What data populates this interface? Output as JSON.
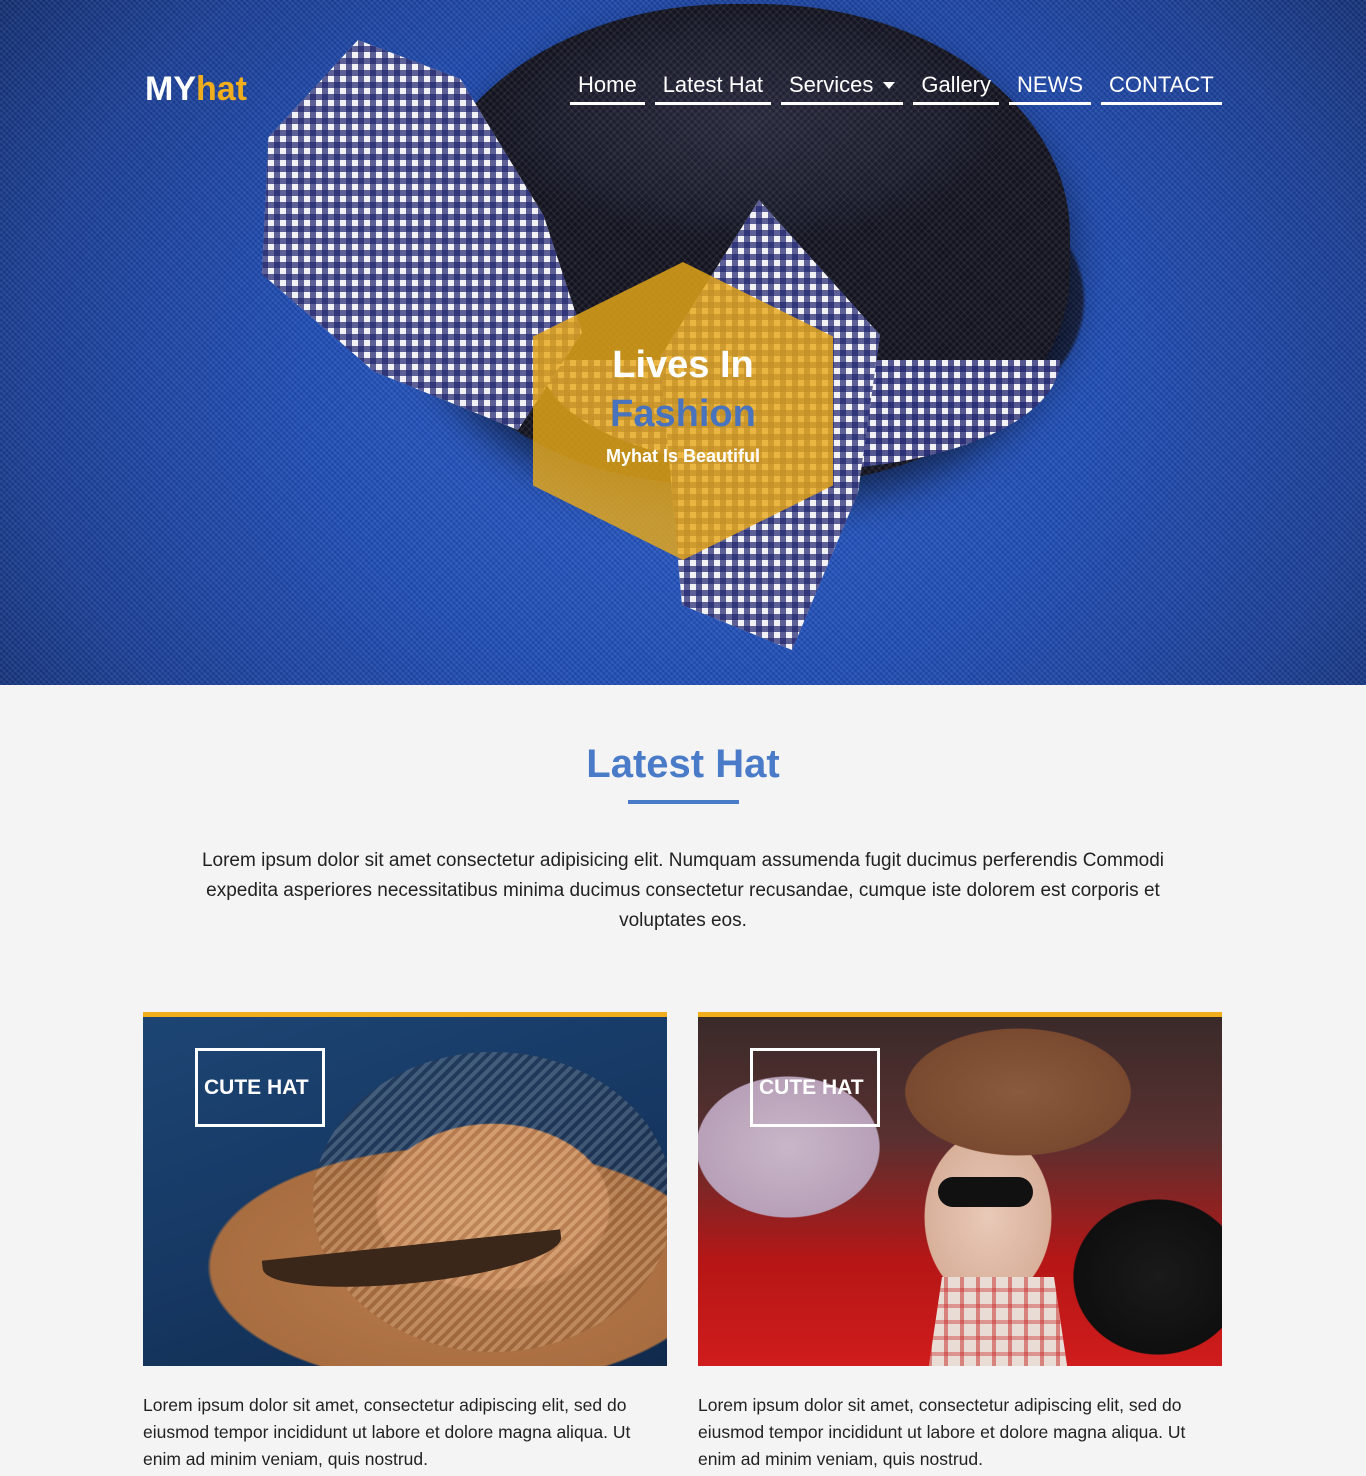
{
  "brand": {
    "logo_part1": "MY",
    "logo_part2": "hat",
    "accent_color": "#f0ae1c",
    "title_color": "#4a7bc8"
  },
  "nav": {
    "items": [
      {
        "label": "Home"
      },
      {
        "label": "Latest Hat"
      },
      {
        "label": "Services",
        "has_dropdown": true
      },
      {
        "label": "Gallery"
      },
      {
        "label": "NEWS"
      },
      {
        "label": "CONTACT"
      }
    ]
  },
  "hero": {
    "title": "Lives In",
    "accent": "Fashion",
    "subtitle": "Myhat Is Beautiful"
  },
  "latest": {
    "title": "Latest Hat",
    "intro": "Lorem ipsum dolor sit amet consectetur adipisicing elit. Numquam assumenda fugit ducimus perferendis Commodi expedita asperiores necessitatibus minima ducimus consectetur recusandae, cumque iste dolorem est corporis et voluptates eos.",
    "cards": [
      {
        "label": "CUTE HAT",
        "text": "Lorem ipsum dolor sit amet, consectetur adipiscing elit, sed do eiusmod tempor incididunt ut labore et dolore magna aliqua. Ut enim ad minim veniam, quis nostrud."
      },
      {
        "label": "CUTE HAT",
        "text": "Lorem ipsum dolor sit amet, consectetur adipiscing elit, sed do eiusmod tempor incididunt ut labore et dolore magna aliqua. Ut enim ad minim veniam, quis nostrud."
      }
    ]
  }
}
